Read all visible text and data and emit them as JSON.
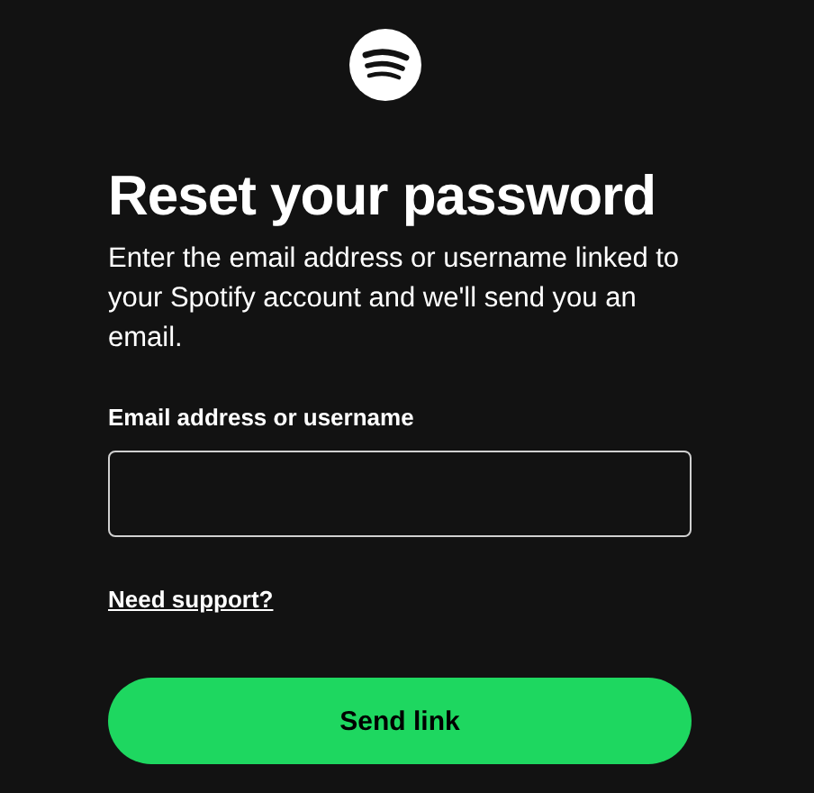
{
  "heading": "Reset your password",
  "description": "Enter the email address or username linked to your Spotify account and we'll send you an email.",
  "email_field": {
    "label": "Email address or username"
  },
  "support_link": "Need support?",
  "submit_button": "Send link"
}
